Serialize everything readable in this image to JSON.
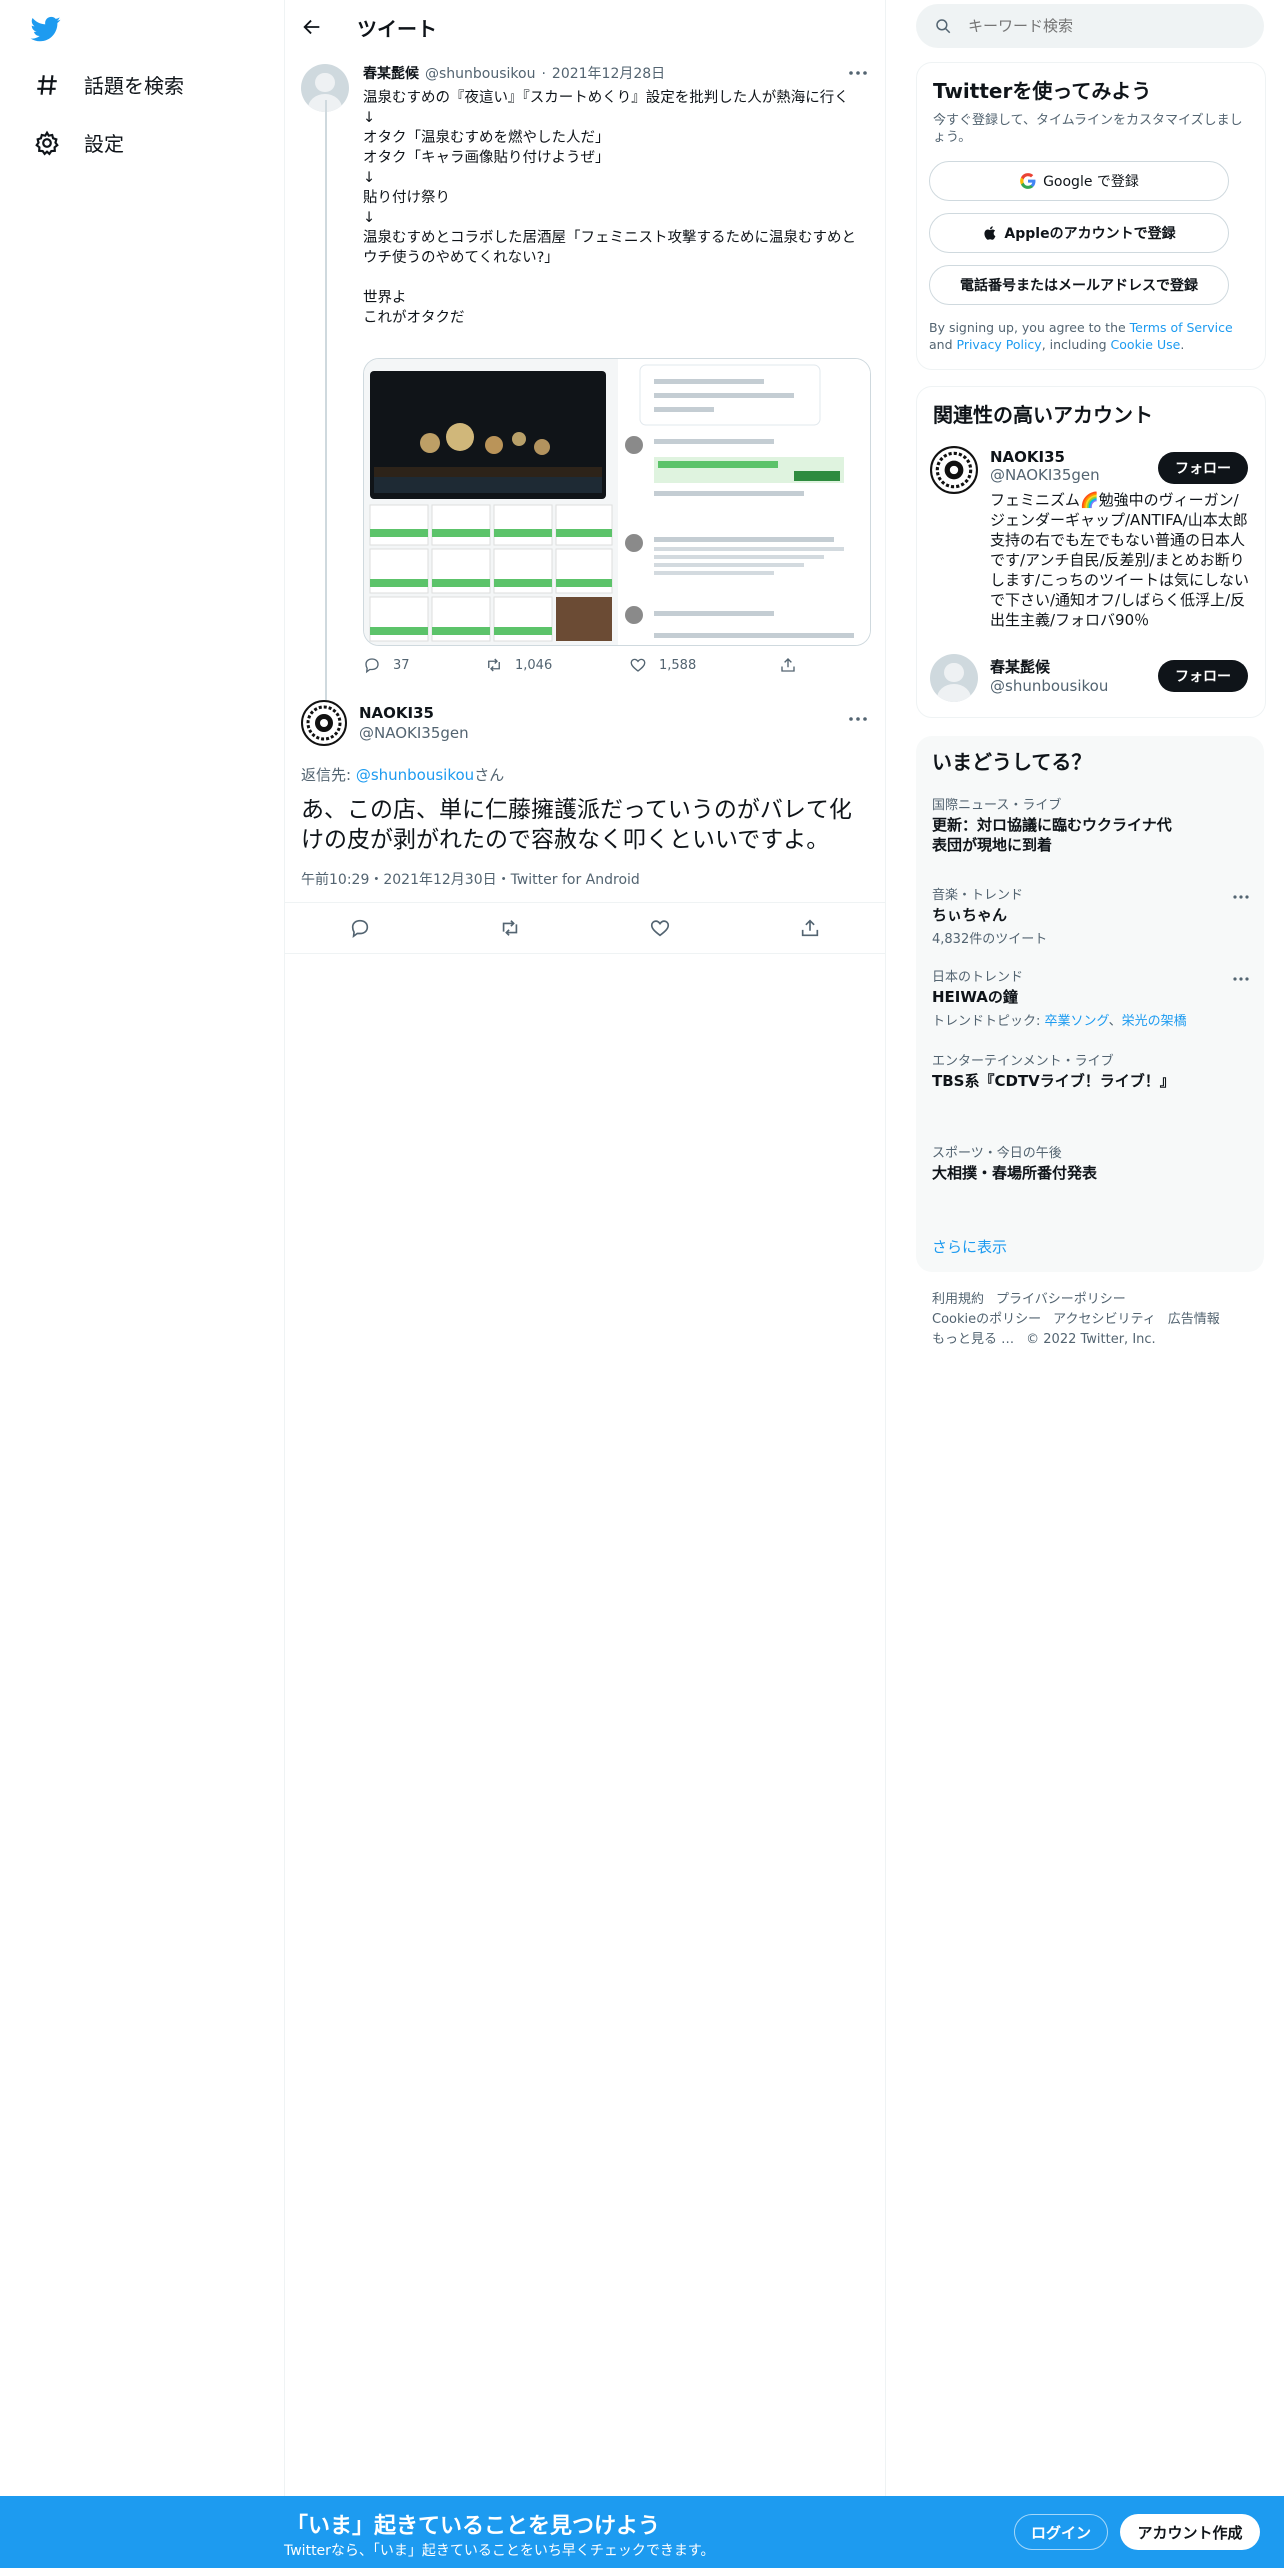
{
  "nav": {
    "explore_label": "話題を検索",
    "settings_label": "設定"
  },
  "header": {
    "title": "ツイート"
  },
  "quoted_tweet": {
    "name": "春某髭候",
    "handle": "@shunbousikou",
    "date": "2021年12月28日",
    "text": "温泉むすめの『夜這い』『スカートめくり』設定を批判した人が熱海に行く\n↓\nオタク「温泉むすめを燃やした人だ」\nオタク「キャラ画像貼り付けようぜ」\n↓\n貼り付け祭り\n↓\n温泉むすめとコラボした居酒屋「フェミニスト攻撃するために温泉むすめとウチ使うのやめてくれない?」\n\n世界よ\nこれがオタクだ",
    "reply_count": "37",
    "retweet_count": "1,046",
    "like_count": "1,588"
  },
  "main_tweet": {
    "name": "NAOKI35",
    "handle": "@NAOKI35gen",
    "reply_prefix": "返信先: ",
    "reply_handle": "@shunbousikou",
    "reply_suffix": "さん",
    "text": "あ、この店、単に仁藤擁護派だっていうのがバレて化けの皮が剥がれたので容赦なく叩くといいですよ。",
    "meta": "午前10:29・2021年12月30日・Twitter for Android"
  },
  "search": {
    "placeholder": "キーワード検索"
  },
  "signup_card": {
    "title": "Twitterを使ってみよう",
    "subtitle": "今すぐ登録して、タイムラインをカスタマイズしましょう。",
    "google_label": "Google で登録",
    "apple_label": "Appleのアカウントで登録",
    "phone_label": "電話番号またはメールアドレスで登録",
    "terms_prefix": "By signing up, you agree to the ",
    "terms_link": "Terms of Service",
    "terms_and": " and ",
    "privacy_link": "Privacy Policy",
    "terms_including": ", including ",
    "cookie_link": "Cookie Use",
    "terms_end": "."
  },
  "related": {
    "title": "関連性の高いアカウント",
    "follow_label": "フォロー",
    "accounts": [
      {
        "name": "NAOKI35",
        "handle": "@NAOKI35gen",
        "bio": "フェミニズム🌈勉強中のヴィーガン/ジェンダーギャップ/ANTIFA/山本太郎支持の右でも左でもない普通の日本人です/アンチ自民/反差別/まとめお断りします/こっちのツイートは気にしないで下さい/通知オフ/しばらく低浮上/反出生主義/フォロバ90％"
      },
      {
        "name": "春某髭候",
        "handle": "@shunbousikou",
        "bio": ""
      }
    ]
  },
  "trends": {
    "title": "いまどうしてる？",
    "items": [
      {
        "category": "国際ニュース・ライブ",
        "title": "更新：対ロ協議に臨むウクライナ代表団が現地に到着",
        "sub": ""
      },
      {
        "category": "音楽・トレンド",
        "title": "ちぃちゃん",
        "sub": "4,832件のツイート"
      },
      {
        "category": "日本のトレンド",
        "title": "HEIWAの鐘",
        "sub_prefix": "トレンドトピック: ",
        "sub_link1": "卒業ソング",
        "sub_sep": "、",
        "sub_link2": "栄光の架橋"
      },
      {
        "category": "エンターテインメント・ライブ",
        "title": "TBS系『CDTVライブ！ライブ！』",
        "sub": ""
      },
      {
        "category": "スポーツ・今日の午後",
        "title": "大相撲・春場所番付発表",
        "sub": ""
      }
    ],
    "show_more": "さらに表示"
  },
  "footer": {
    "links": [
      "利用規約",
      "プライバシーポリシー",
      "Cookieのポリシー",
      "アクセシビリティ",
      "広告情報",
      "もっと見る …"
    ],
    "copyright": "© 2022 Twitter, Inc."
  },
  "banner": {
    "title": "「いま」起きていることを見つけよう",
    "subtitle": "Twitterなら、「いま」起きていることをいち早くチェックできます。",
    "login_label": "ログイン",
    "signup_label": "アカウント作成"
  },
  "colors": {
    "accent": "#1d9bf0",
    "text": "#0f1419",
    "muted": "#536471"
  }
}
